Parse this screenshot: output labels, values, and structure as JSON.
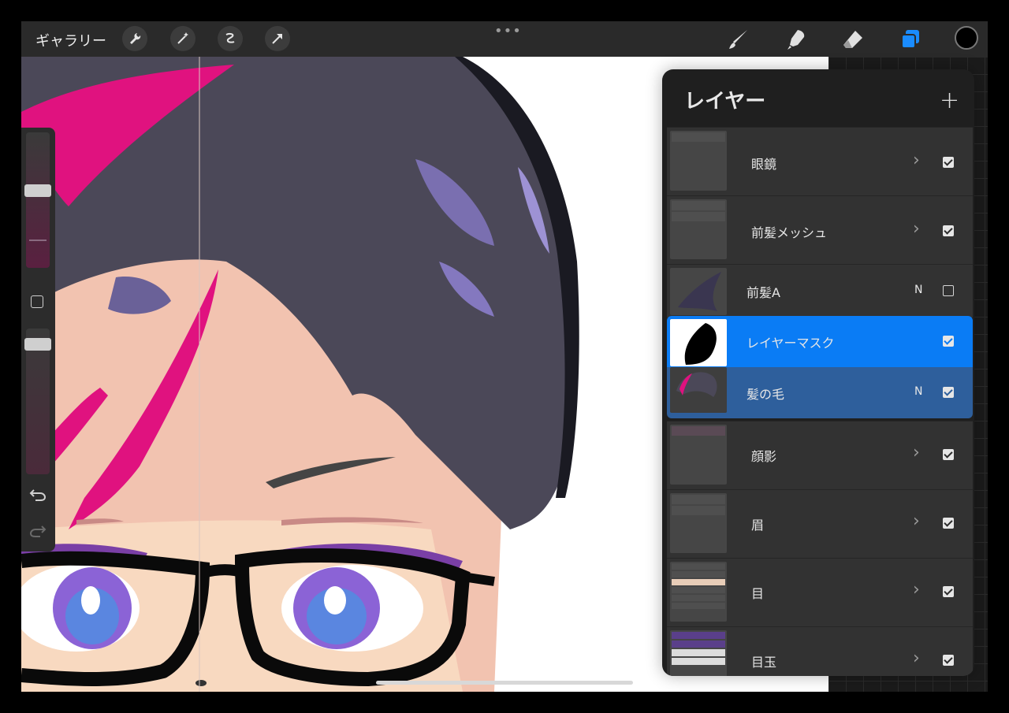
{
  "toolbar": {
    "gallery_label": "ギャラリー",
    "left_tools": [
      "wrench-icon",
      "magic-wand-icon",
      "selection-icon",
      "transform-arrow-icon"
    ],
    "center_menu": "•••",
    "right_tools": [
      "brush-icon",
      "smudge-icon",
      "eraser-icon",
      "layers-icon"
    ],
    "active_tool_color": "#1a8cff",
    "current_color": "#000000"
  },
  "sidebar": {
    "controls": [
      "brush-size-slider",
      "modify-square-icon",
      "opacity-slider",
      "undo-icon",
      "redo-icon"
    ]
  },
  "layers_panel": {
    "title": "レイヤー",
    "add_label": "+",
    "layers": [
      {
        "name": "眼鏡",
        "kind": "group",
        "visible": true
      },
      {
        "name": "前髪メッシュ",
        "kind": "group",
        "visible": true
      },
      {
        "name": "前髪A",
        "kind": "layer",
        "blend": "N",
        "visible": false
      },
      {
        "name": "レイヤーマスク",
        "kind": "mask",
        "visible": true
      },
      {
        "name": "髪の毛",
        "kind": "layer",
        "blend": "N",
        "visible": true
      },
      {
        "name": "顔影",
        "kind": "group",
        "visible": true
      },
      {
        "name": "眉",
        "kind": "group",
        "visible": true
      },
      {
        "name": "目",
        "kind": "group",
        "visible": true
      },
      {
        "name": "目玉",
        "kind": "group",
        "visible": true
      }
    ]
  },
  "colors": {
    "selected_row": "#0a7cf5",
    "parent_row": "#2e5f9c",
    "panel_bg": "#1f1f1f"
  }
}
